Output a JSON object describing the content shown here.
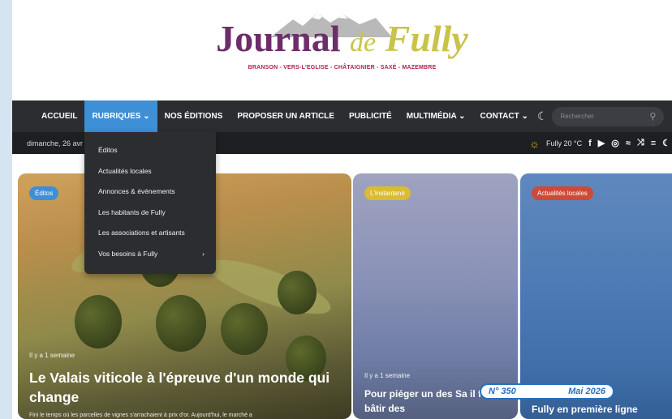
{
  "header": {
    "logo_journal": "Journal",
    "logo_de": "de",
    "logo_fully": "Fully",
    "logo_subtitle": "BRANSON - VERS-L'EGLISE - CHÂTAIGNIER - SAXÉ - MAZEMBRE"
  },
  "nav": {
    "items": [
      "ACCUEIL",
      "RUBRIQUES ⌄",
      "NOS ÉDITIONS",
      "PROPOSER UN ARTICLE",
      "PUBLICITÉ",
      "MULTIMÉDIA ⌄",
      "CONTACT ⌄"
    ],
    "active_index": 1,
    "search_placeholder": "Rechercher"
  },
  "topbar": {
    "date": "dimanche, 26 avr",
    "weather": "Fully 20 °C"
  },
  "dropdown": {
    "items": [
      "Éditos",
      "Actualités locales",
      "Annonces & événements",
      "Les habitants de Fully",
      "Les associations et artisants",
      "Vos besoins à Fully"
    ],
    "last_arrow": "›"
  },
  "cards": [
    {
      "badge": "Éditos",
      "meta": "Il y a 1 semaine",
      "title": "Le Valais viticole à l'épreuve d'un monde qui change",
      "excerpt": "Fini le temps où les parcelles de vignes s'arrachaient à prix d'or. Aujourd'hui, le marché a"
    },
    {
      "badge": "L'instantané",
      "meta": "Il y a 1 semaine",
      "title": "Pour piéger un des Sa il faut bâtir des"
    },
    {
      "badge": "Actualités locales",
      "title": "Fully en première ligne"
    }
  ],
  "issue": {
    "number": "N° 350",
    "date": "Mai 2026"
  },
  "colors": {
    "nav_bg": "#2b2d31",
    "active": "#3d8fd6",
    "brand_purple": "#6d2d6b",
    "brand_gold": "#c9c34a",
    "issue_blue": "#2a6fbf"
  }
}
